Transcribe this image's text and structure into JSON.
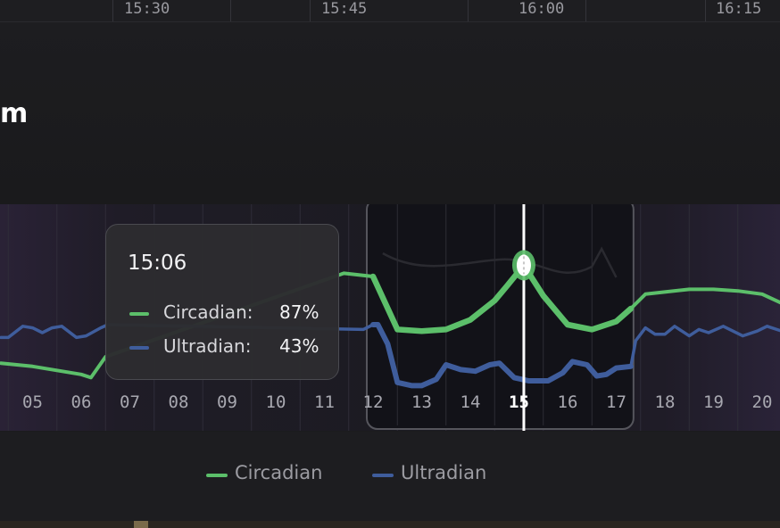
{
  "timeline": {
    "labels": [
      "15:30",
      "15:45",
      "16:00",
      "16:15"
    ]
  },
  "header": {
    "title_fragment": "m"
  },
  "tooltip": {
    "time": "15:06",
    "rows": [
      {
        "label": "Circadian:",
        "value": "87%"
      },
      {
        "label": "Ultradian:",
        "value": "43%"
      }
    ]
  },
  "legend": {
    "items": [
      "Circadian",
      "Ultradian"
    ]
  },
  "colors": {
    "circadian": "#5cbf6a",
    "ultradian": "#3f5d9c",
    "background": "#1b1b1d",
    "cursor": "#ffffff"
  },
  "chart_data": {
    "type": "line",
    "x_hours": [
      5,
      6,
      7,
      8,
      9,
      10,
      11,
      12,
      13,
      14,
      15,
      16,
      17,
      18,
      19,
      20
    ],
    "x_tick_labels": [
      "05",
      "06",
      "07",
      "08",
      "09",
      "10",
      "11",
      "12",
      "13",
      "14",
      "15",
      "16",
      "17",
      "18",
      "19",
      "20"
    ],
    "highlighted_tick": "15",
    "ylim": [
      0,
      100
    ],
    "selection": {
      "start_hour": 12,
      "end_hour": 17.3
    },
    "cursor_hour": 15.1,
    "series": [
      {
        "name": "Circadian",
        "points": [
          [
            4.35,
            26
          ],
          [
            5.0,
            24
          ],
          [
            6.0,
            19
          ],
          [
            6.2,
            17
          ],
          [
            6.5,
            30
          ],
          [
            11.4,
            82
          ],
          [
            12.0,
            80
          ],
          [
            12.5,
            47
          ],
          [
            13.0,
            46
          ],
          [
            13.5,
            47
          ],
          [
            14.0,
            53
          ],
          [
            14.5,
            65
          ],
          [
            14.75,
            74
          ],
          [
            15.1,
            87
          ],
          [
            15.5,
            68
          ],
          [
            16.0,
            50
          ],
          [
            16.5,
            47
          ],
          [
            17.0,
            52
          ],
          [
            17.3,
            60
          ],
          [
            17.6,
            69
          ],
          [
            18.5,
            72
          ],
          [
            19.0,
            72
          ],
          [
            19.5,
            71
          ],
          [
            20.0,
            69
          ],
          [
            20.5,
            62
          ]
        ]
      },
      {
        "name": "Ultradian",
        "points": [
          [
            4.35,
            42
          ],
          [
            4.5,
            42
          ],
          [
            4.8,
            49
          ],
          [
            5.0,
            48
          ],
          [
            5.2,
            45
          ],
          [
            5.4,
            48
          ],
          [
            5.6,
            49
          ],
          [
            5.9,
            42
          ],
          [
            6.1,
            43
          ],
          [
            6.4,
            48
          ],
          [
            6.55,
            50
          ],
          [
            11.8,
            47
          ],
          [
            12.0,
            50
          ],
          [
            12.1,
            50
          ],
          [
            12.3,
            38
          ],
          [
            12.5,
            14
          ],
          [
            12.8,
            12
          ],
          [
            13.0,
            12
          ],
          [
            13.3,
            16
          ],
          [
            13.5,
            25
          ],
          [
            13.8,
            22
          ],
          [
            14.1,
            21
          ],
          [
            14.4,
            25
          ],
          [
            14.6,
            26
          ],
          [
            14.9,
            17
          ],
          [
            15.2,
            15
          ],
          [
            15.6,
            15
          ],
          [
            15.9,
            20
          ],
          [
            16.1,
            27
          ],
          [
            16.4,
            25
          ],
          [
            16.6,
            18
          ],
          [
            16.8,
            19
          ],
          [
            17.0,
            23
          ],
          [
            17.3,
            24
          ],
          [
            17.4,
            40
          ],
          [
            17.6,
            48
          ],
          [
            17.8,
            44
          ],
          [
            18.0,
            44
          ],
          [
            18.2,
            49
          ],
          [
            18.5,
            43
          ],
          [
            18.7,
            47
          ],
          [
            18.9,
            45
          ],
          [
            19.2,
            49
          ],
          [
            19.6,
            43
          ],
          [
            19.9,
            46
          ],
          [
            20.1,
            49
          ],
          [
            20.5,
            45
          ]
        ]
      }
    ]
  }
}
